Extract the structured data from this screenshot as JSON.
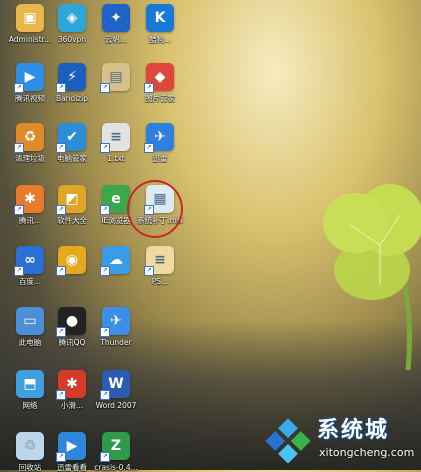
{
  "desktop": {
    "icons": [
      {
        "label": "Administr...",
        "icon": "folder-user-icon",
        "color": "#e8b64a"
      },
      {
        "label": "360vpn",
        "icon": "vpn-icon",
        "color": "#2fa6d8"
      },
      {
        "label": "云帆...",
        "icon": "cloud-icon",
        "color": "#1e63c6"
      },
      {
        "label": "酷狗...",
        "icon": "kugou-icon",
        "color": "#1a78d6"
      },
      {
        "label": "腾讯视频",
        "icon": "video-play-icon",
        "color": "#2e8fe6"
      },
      {
        "label": "Bandizip",
        "icon": "bandizip-icon",
        "color": "#1d5fbf"
      },
      {
        "label": "",
        "icon": "document-icon",
        "color": "#d8c08a"
      },
      {
        "label": "图片管家",
        "icon": "photo-icon",
        "color": "#e0473b"
      },
      {
        "label": "清理垃圾",
        "icon": "cleaner-icon",
        "color": "#e08a2a"
      },
      {
        "label": "电脑管家",
        "icon": "shield-icon",
        "color": "#2a8fd8"
      },
      {
        "label": "1.txt",
        "icon": "file-icon",
        "color": "#e2e2e2"
      },
      {
        "label": "迅雷",
        "icon": "thunder-icon",
        "color": "#2d7fe0"
      },
      {
        "label": "腾讯...",
        "icon": "app-icon",
        "color": "#e77b2c"
      },
      {
        "label": "软件大全",
        "icon": "apps-icon",
        "color": "#e0a526"
      },
      {
        "label": "IE浏览器",
        "icon": "ie-icon",
        "color": "#3aa84a"
      },
      {
        "label": "系统补丁.msi",
        "icon": "msi-file-icon",
        "color": "#dfe9f2"
      },
      {
        "label": "百度...",
        "icon": "baidu-icon",
        "color": "#2b6fd4"
      },
      {
        "label": "",
        "icon": "game-icon",
        "color": "#e6a81f"
      },
      {
        "label": "",
        "icon": "cloud-drive-icon",
        "color": "#3a9be6"
      },
      {
        "label": "PS...",
        "icon": "file-icon",
        "color": "#eed9a0"
      },
      {
        "label": "此电脑",
        "icon": "computer-icon",
        "color": "#4b8fd6"
      },
      {
        "label": "腾讯QQ",
        "icon": "qq-penguin-icon",
        "color": "#222222"
      },
      {
        "label": "Thunder",
        "icon": "thunder-bird-icon",
        "color": "#3b8fe8"
      },
      {
        "label": "网络",
        "icon": "network-icon",
        "color": "#3fa0e0"
      },
      {
        "label": "小滑...",
        "icon": "app-icon",
        "color": "#d63b2a"
      },
      {
        "label": "Word 2007",
        "icon": "word-icon",
        "color": "#2a5cb0"
      },
      {
        "label": "回收站",
        "icon": "recycle-bin-icon",
        "color": "#bcd6ea"
      },
      {
        "label": "迅雷看看",
        "icon": "player-icon",
        "color": "#2d88dc"
      },
      {
        "label": "crasis-0.4...",
        "icon": "installer-icon",
        "color": "#2f9a4c"
      }
    ]
  },
  "watermark": {
    "text_main": "系统城",
    "text_url": "xitongcheng.com",
    "logo": "windows-logo-icon"
  }
}
